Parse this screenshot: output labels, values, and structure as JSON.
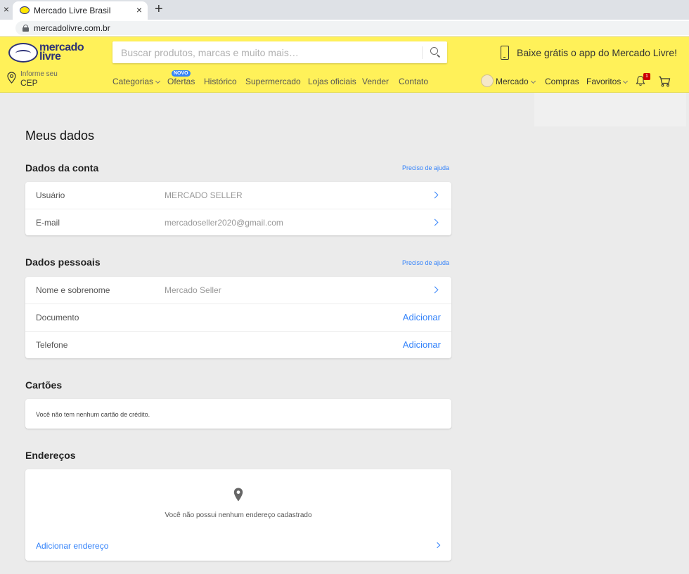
{
  "browser": {
    "tab_title": "Mercado Livre Brasil",
    "tab_close": "×",
    "new_tab": "+",
    "url": "mercadolivre.com.br"
  },
  "header": {
    "logo_line1": "mercado",
    "logo_line2": "livre",
    "search_placeholder": "Buscar produtos, marcas e muito mais…",
    "app_promo": "Baixe grátis o app do Mercado Livre!",
    "cep_small": "Informe seu",
    "cep_big": "CEP",
    "nav": {
      "categorias": "Categorias",
      "ofertas": "Ofertas",
      "novo_badge": "NOVO",
      "historico": "Histórico",
      "supermercado": "Supermercado",
      "lojas": "Lojas oficiais",
      "vender": "Vender",
      "contato": "Contato"
    },
    "user": {
      "name": "Mercado",
      "compras": "Compras",
      "favoritos": "Favoritos",
      "notifications_count": "1"
    },
    "colors": {
      "brand_yellow": "#fff159",
      "link_blue": "#3483fa",
      "logo_navy": "#2d3277"
    }
  },
  "page": {
    "title": "Meus dados",
    "account": {
      "title": "Dados da conta",
      "help": "Preciso de ajuda",
      "rows": [
        {
          "label": "Usuário",
          "value": "MERCADO SELLER"
        },
        {
          "label": "E-mail",
          "value": "mercadoseller2020@gmail.com"
        }
      ]
    },
    "personal": {
      "title": "Dados pessoais",
      "help": "Preciso de ajuda",
      "name_label": "Nome e sobrenome",
      "name_value": "Mercado Seller",
      "document_label": "Documento",
      "document_action": "Adicionar",
      "phone_label": "Telefone",
      "phone_action": "Adicionar"
    },
    "cards": {
      "title": "Cartões",
      "empty": "Você não tem nenhum cartão de crédito."
    },
    "addresses": {
      "title": "Endereços",
      "empty": "Você não possui nenhum endereço cadastrado",
      "add": "Adicionar endereço"
    }
  }
}
